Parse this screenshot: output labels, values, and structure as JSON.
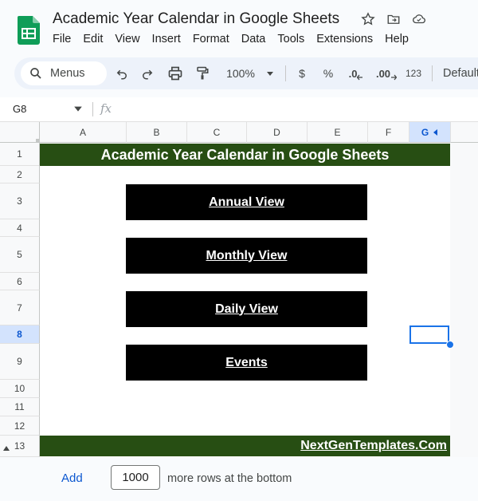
{
  "window": {
    "title": "Academic Year Calendar in Google Sheets"
  },
  "menu": [
    "File",
    "Edit",
    "View",
    "Insert",
    "Format",
    "Data",
    "Tools",
    "Extensions",
    "Help"
  ],
  "toolbar": {
    "menus_label": "Menus",
    "zoom": "100%",
    "currency": "$",
    "percent": "%",
    "decrease_decimal": ".0",
    "increase_decimal": ".00",
    "number_format": "123",
    "font_name": "Default"
  },
  "formula_bar": {
    "cell_ref": "G8",
    "fx_label": "fx",
    "value": ""
  },
  "columns": [
    "A",
    "B",
    "C",
    "D",
    "E",
    "F",
    "G"
  ],
  "selected_column": "G",
  "rows": [
    "1",
    "2",
    "3",
    "4",
    "5",
    "6",
    "7",
    "8",
    "9",
    "10",
    "11",
    "12",
    "13"
  ],
  "selected_row": "8",
  "sheet": {
    "title": "Academic Year Calendar in Google Sheets",
    "buttons": [
      "Annual View",
      "Monthly View",
      "Daily View",
      "Events"
    ],
    "footer": "NextGenTemplates.Com"
  },
  "add_rows": {
    "add_label": "Add",
    "count": "1000",
    "suffix": "more rows at the bottom"
  },
  "colors": {
    "banner_green": "#274e13",
    "button_black": "#000000",
    "selection_blue": "#1a73e8",
    "sheets_green": "#0f9d58"
  }
}
